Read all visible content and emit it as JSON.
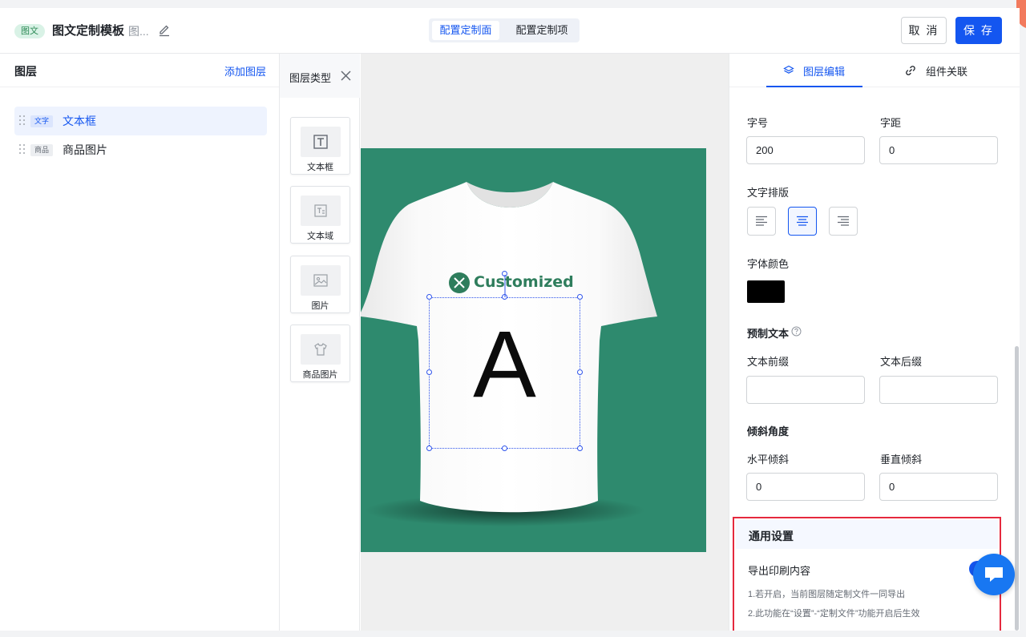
{
  "header": {
    "badge": "图文",
    "title": "图文定制模板",
    "title_more": "图...",
    "segments": [
      "配置定制面",
      "配置定制项"
    ],
    "cancel": "取 消",
    "save": "保 存"
  },
  "layers": {
    "title": "图层",
    "add": "添加图层",
    "items": [
      {
        "tag": "文字",
        "name": "文本框"
      },
      {
        "tag": "商品",
        "name": "商品图片"
      }
    ]
  },
  "types": {
    "title": "图层类型",
    "items": [
      "文本框",
      "文本域",
      "图片",
      "商品图片"
    ]
  },
  "canvas": {
    "logo_text": "Customized",
    "text_layer_value": "A"
  },
  "right": {
    "tabs": [
      "图层编辑",
      "组件关联"
    ],
    "font_size_label": "字号",
    "font_size_value": "200",
    "letter_spacing_label": "字距",
    "letter_spacing_value": "0",
    "text_align_label": "文字排版",
    "font_color_label": "字体颜色",
    "font_color": "#000000",
    "preset_text_label": "预制文本",
    "prefix_label": "文本前缀",
    "prefix_value": "",
    "suffix_label": "文本后缀",
    "suffix_value": "",
    "skew_label": "倾斜角度",
    "h_skew_label": "水平倾斜",
    "h_skew_value": "0",
    "v_skew_label": "垂直倾斜",
    "v_skew_value": "0",
    "general": {
      "title": "通用设置",
      "export_label": "导出印刷内容",
      "note1": "1.若开启，当前图层随定制文件一同导出",
      "note2": "2.此功能在“设置”-“定制文件”功能开启后生效"
    }
  },
  "colors": {
    "accent": "#1456f0",
    "canvas_bg": "#2e8a6e",
    "highlight_border": "#e5293e"
  }
}
